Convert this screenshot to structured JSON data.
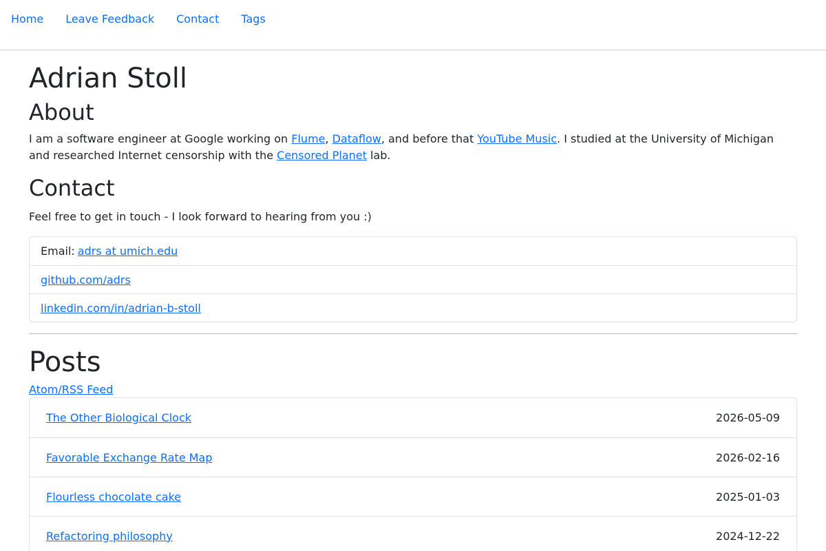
{
  "nav": {
    "items": [
      {
        "label": "Home"
      },
      {
        "label": "Leave Feedback"
      },
      {
        "label": "Contact"
      },
      {
        "label": "Tags"
      }
    ]
  },
  "header": {
    "name": "Adrian Stoll"
  },
  "about": {
    "heading": "About",
    "text_1": "I am a software engineer at Google working on ",
    "link_flume": "Flume",
    "sep_1": ", ",
    "link_dataflow": "Dataflow",
    "text_2": ", and before that ",
    "link_youtube_music": "YouTube Music",
    "text_3": ". I studied at the University of Michigan and researched Internet censorship with the ",
    "link_censored_planet": "Censored Planet",
    "text_4": " lab."
  },
  "contact": {
    "heading": "Contact",
    "text": "Feel free to get in touch - I look forward to hearing from you :)",
    "email_label": "Email:",
    "email_link": "adrs at umich.edu",
    "github_link": "github.com/adrs",
    "linkedin_link": "linkedin.com/in/adrian-b-stoll"
  },
  "posts": {
    "heading": "Posts",
    "feed_link": "Atom/RSS Feed",
    "items": [
      {
        "title": "The Other Biological Clock",
        "date": "2026-05-09"
      },
      {
        "title": "Favorable Exchange Rate Map",
        "date": "2026-02-16"
      },
      {
        "title": "Flourless chocolate cake",
        "date": "2025-01-03"
      },
      {
        "title": "Refactoring philosophy",
        "date": "2024-12-22"
      }
    ]
  },
  "colors": {
    "link": "#0d6efd",
    "text": "#212529",
    "border": "#dee2e6"
  }
}
